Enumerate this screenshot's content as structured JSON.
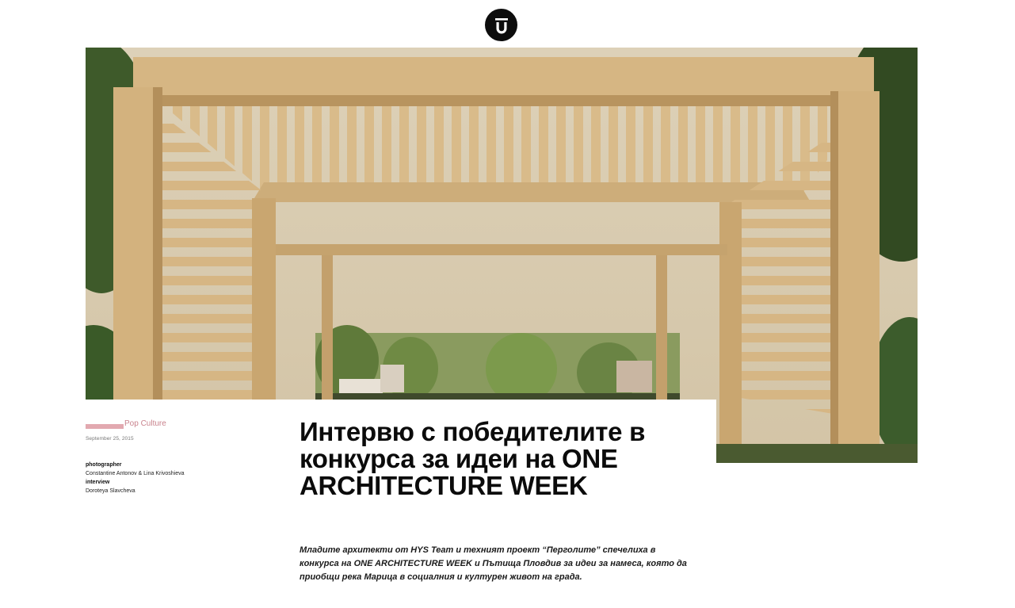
{
  "site": {
    "logo_icon": "u-logo-icon"
  },
  "article": {
    "category": "Pop Culture",
    "date": "September 25, 2015",
    "credits": [
      {
        "role": "photographer",
        "name": "Constantine Antonov & Lina Krivoshieva"
      },
      {
        "role": "interview",
        "name": "Doroteya Slavcheva"
      }
    ],
    "title": "Интервю с победителите в конкурса за идеи на ONE ARCHITECTURE WEEK",
    "lead": "Младите архитекти от HYS Team и техният проект “Перголите” спечелиха в конкурса на ONE ARCHITECTURE WEEK и Пътища Пловдив за идеи за намеса, която да приобщи река Марица в социалния и културен живот на града."
  },
  "colors": {
    "accent": "#e2a9b0",
    "category_text": "#c9838d",
    "sky": "#d9ccb2",
    "wood": "#d8b988"
  }
}
